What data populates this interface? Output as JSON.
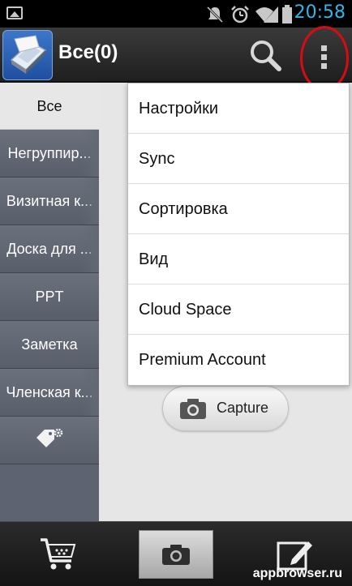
{
  "status_bar": {
    "time": "20:58",
    "icons": [
      "image-icon",
      "mute-icon",
      "alarm-icon",
      "wifi-icon",
      "signal-icon",
      "battery-icon"
    ]
  },
  "action_bar": {
    "title": "Все(0)",
    "icons": [
      "app-icon",
      "search-icon",
      "overflow-menu-icon"
    ]
  },
  "sidebar": {
    "items": [
      {
        "label": "Все"
      },
      {
        "label": "Негруппир..."
      },
      {
        "label": "Визитная к..."
      },
      {
        "label": "Доска для ..."
      },
      {
        "label": "PPT"
      },
      {
        "label": "Заметка"
      },
      {
        "label": "Членская к..."
      }
    ],
    "tag_settings_icon": "tag-settings-icon"
  },
  "menu": {
    "items": [
      {
        "label": "Настройки"
      },
      {
        "label": "Sync"
      },
      {
        "label": "Сортировка"
      },
      {
        "label": "Вид"
      },
      {
        "label": "Cloud Space"
      },
      {
        "label": "Premium Account"
      }
    ]
  },
  "main": {
    "capture_label": "Capture"
  },
  "bottom_bar": {
    "icons": [
      "cart-icon",
      "camera-icon",
      "edit-icon"
    ],
    "watermark": "appbrowser.ru"
  },
  "colors": {
    "accent_time": "#33b5e5",
    "highlight_circle": "#d90b12",
    "sidebar_bg": "#5d6370"
  }
}
